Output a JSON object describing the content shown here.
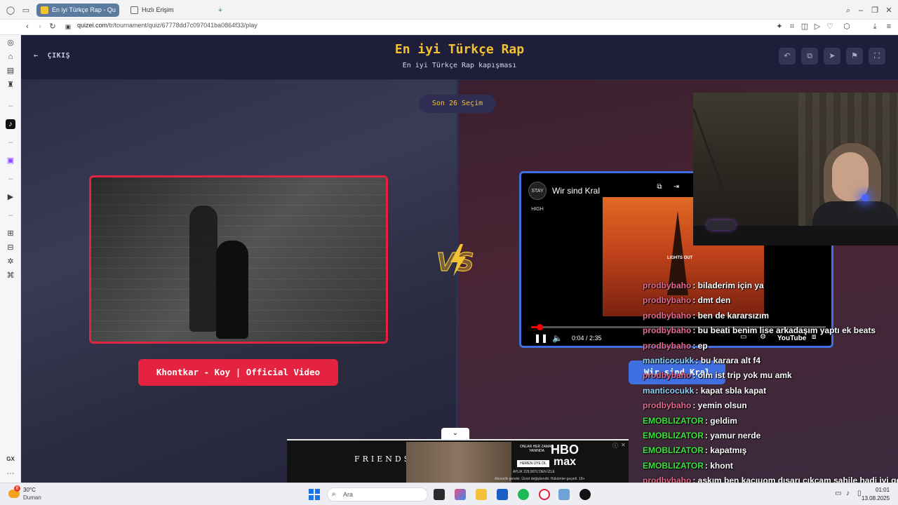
{
  "browser": {
    "tabs": [
      {
        "label": "En iyi Türkçe Rap - Qu",
        "active": true
      },
      {
        "label": "Hızlı Erişim",
        "active": false
      }
    ],
    "new_tab": "+",
    "url_host": "quizei.com",
    "url_path": "/tr/tournament/quiz/67778dd7c097041ba0864f33/play"
  },
  "header": {
    "back_label": "ÇIKIŞ",
    "title": "En iyi Türkçe Rap",
    "subtitle": "En iyi Türkçe Rap kapışması"
  },
  "round_badge": "Son 26 Seçim",
  "left_choice": {
    "label": "Khontkar - Koy | Official Video"
  },
  "right_choice": {
    "label": "Wir sind Kral",
    "video_title": "Wir sind Kral",
    "channel": "STAY HIGH",
    "art_text": "LIGHTS OUT",
    "time": "0:04 / 2:35",
    "progress": 0.028,
    "brand": "YouTube"
  },
  "chat": [
    {
      "user": "prodbybaho",
      "color": "#e36b8e",
      "text": "biladerim için ya"
    },
    {
      "user": "prodbybaho",
      "color": "#e36b8e",
      "text": "dmt den"
    },
    {
      "user": "prodbybaho",
      "color": "#e36b8e",
      "text": "ben de kararsızım"
    },
    {
      "user": "prodbybaho",
      "color": "#e36b8e",
      "text": "bu beati benim lise arkadaşım yaptı ek beats"
    },
    {
      "user": "prodbybaho",
      "color": "#e36b8e",
      "text": "ep"
    },
    {
      "user": "manticocukk",
      "color": "#8fd3f4",
      "text": "bu karara alt f4"
    },
    {
      "user": "prodbybaho",
      "color": "#e36b8e",
      "text": "olm ist trip yok mu amk"
    },
    {
      "user": "manticocukk",
      "color": "#8fd3f4",
      "text": "kapat sbla kapat"
    },
    {
      "user": "prodbybaho",
      "color": "#e36b8e",
      "text": "yemin olsun"
    },
    {
      "user": "EMOBLIZATOR",
      "color": "#39e639",
      "text": "geldim"
    },
    {
      "user": "EMOBLIZATOR",
      "color": "#39e639",
      "text": "yamur nerde"
    },
    {
      "user": "EMOBLIZATOR",
      "color": "#39e639",
      "text": "kapatmış"
    },
    {
      "user": "EMOBLIZATOR",
      "color": "#39e639",
      "text": "khont"
    },
    {
      "user": "prodbybaho",
      "color": "#e36b8e",
      "text": "askım ben kaçıuom dışarı çıkcam sahile hadi iyi gecel"
    },
    {
      "user": "EMOBLIZATOR",
      "color": "#39e639",
      "text": "khont un sevdişim parçalarından"
    }
  ],
  "ad": {
    "friends": "FRIENDS",
    "onlar": "ONLAR HER ZAMAN YANINDA",
    "cta": "HEMEN ÜYE OL",
    "price": "AYLIK 229,90TL'DEN İZLE",
    "brand_top": "HBO",
    "brand_bottom": "max",
    "fine_print": "Abonelik gerekir. Ücret değişkendir. Hükümler geçerli. 18+"
  },
  "taskbar": {
    "weather_temp": "30°C",
    "weather_cond": "Duman",
    "weather_badge": "8",
    "search_placeholder": "Ara",
    "time": "01:01",
    "date": "13.08.2025"
  },
  "sidebar": {
    "gx_label": "GX",
    "more_label": "···"
  },
  "colors": {
    "accent_yellow": "#f1c232",
    "left_red": "#e3233f",
    "right_blue": "#3f6fe0",
    "page_bg": "#232242"
  }
}
